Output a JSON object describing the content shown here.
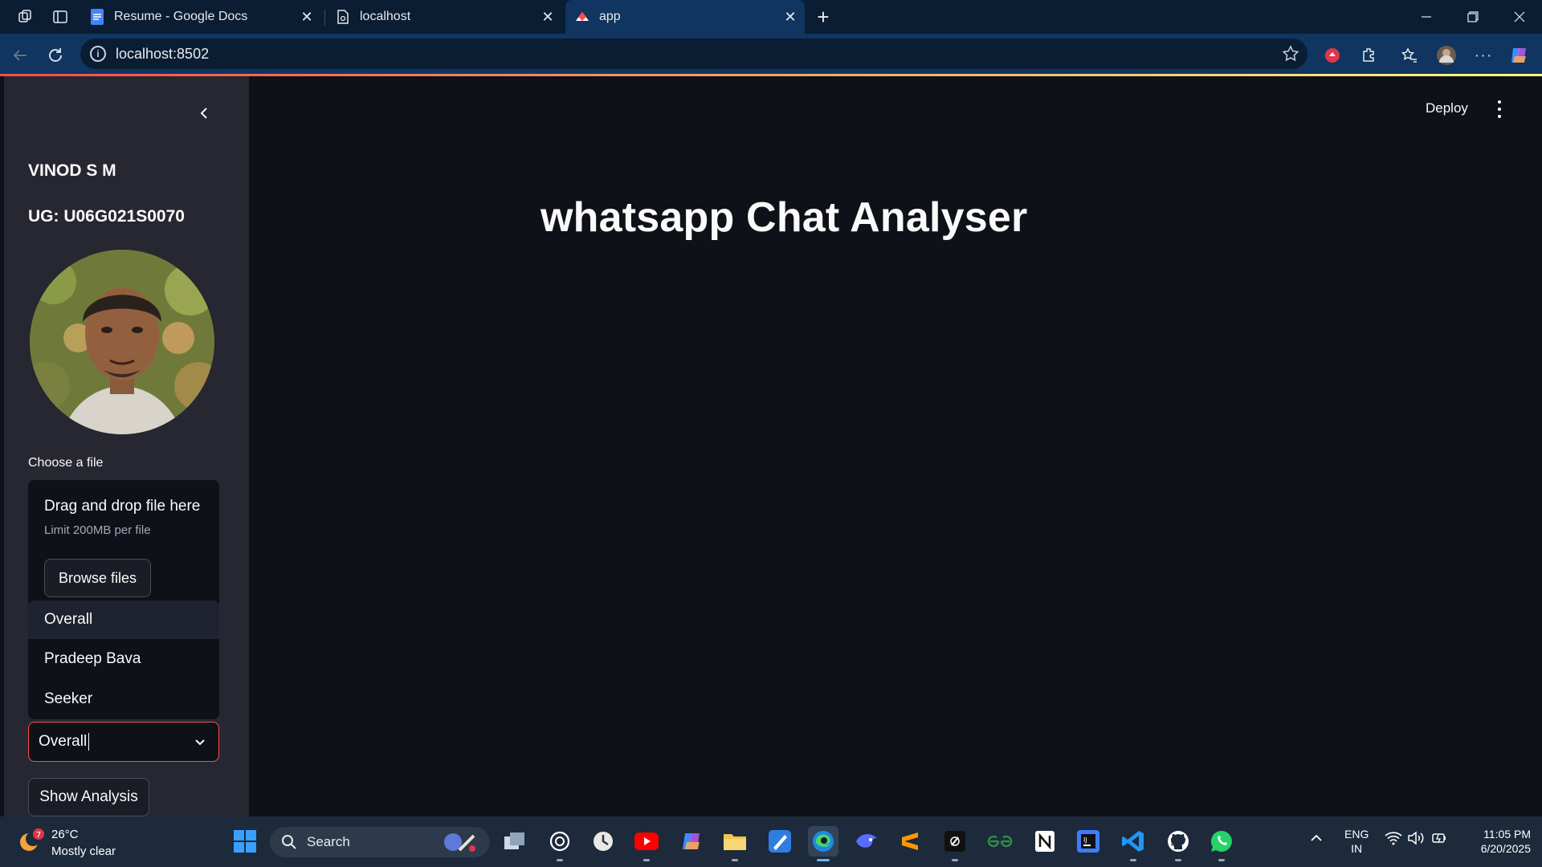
{
  "browser": {
    "tabs": [
      {
        "title": "Resume - Google Docs",
        "icon": "google-docs-icon"
      },
      {
        "title": "localhost",
        "icon": "page-icon"
      },
      {
        "title": "app",
        "icon": "streamlit-icon"
      }
    ],
    "url": "localhost:8502"
  },
  "app": {
    "sidebar": {
      "name": "VINOD S M",
      "id": "UG: U06G021S0070",
      "file_label": "Choose a file",
      "drop_text": "Drag and drop file here",
      "limit_text": "Limit 200MB per file",
      "browse_label": "Browse files",
      "options": [
        "Overall",
        "Pradeep Bava",
        "Seeker"
      ],
      "selected": "Overall",
      "show_button": "Show Analysis"
    },
    "header": {
      "deploy_label": "Deploy"
    },
    "title": "whatsapp Chat Analyser"
  },
  "taskbar": {
    "weather": {
      "temp": "26°C",
      "condition": "Mostly clear",
      "badge": "7"
    },
    "search_placeholder": "Search",
    "lang": {
      "line1": "ENG",
      "line2": "IN"
    },
    "time": "11:05 PM",
    "date": "6/20/2025"
  },
  "colors": {
    "accent": "#ff4b4b",
    "sidebar_bg": "#262730",
    "main_bg": "#0e1117",
    "chrome": "#0f3560"
  }
}
